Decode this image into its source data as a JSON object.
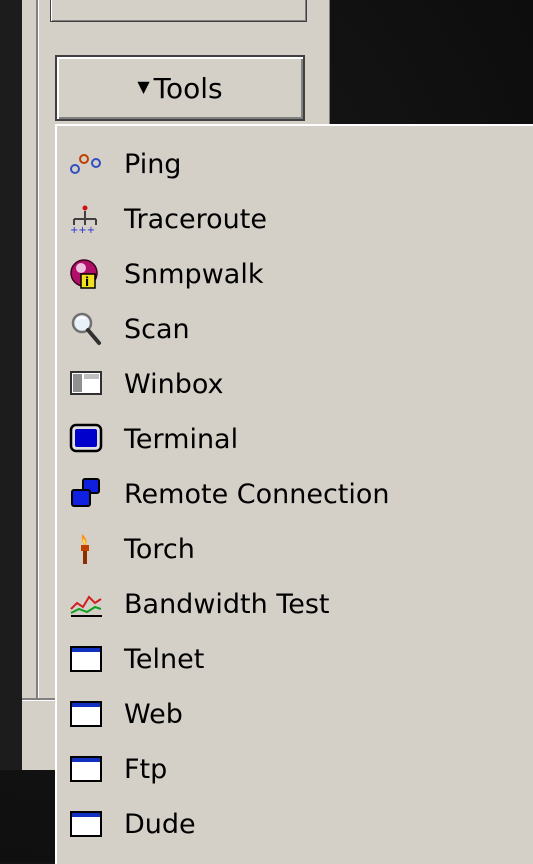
{
  "tools_button": {
    "label": "Tools"
  },
  "menu": {
    "items": [
      {
        "label": "Ping",
        "icon": "ping-icon"
      },
      {
        "label": "Traceroute",
        "icon": "traceroute-icon"
      },
      {
        "label": "Snmpwalk",
        "icon": "snmpwalk-icon"
      },
      {
        "label": "Scan",
        "icon": "magnifier-icon"
      },
      {
        "label": "Winbox",
        "icon": "winbox-icon"
      },
      {
        "label": "Terminal",
        "icon": "terminal-icon"
      },
      {
        "label": "Remote Connection",
        "icon": "remote-connection-icon"
      },
      {
        "label": "Torch",
        "icon": "torch-icon"
      },
      {
        "label": "Bandwidth Test",
        "icon": "bandwidth-test-icon"
      },
      {
        "label": "Telnet",
        "icon": "window-icon"
      },
      {
        "label": "Web",
        "icon": "window-icon"
      },
      {
        "label": "Ftp",
        "icon": "window-icon"
      },
      {
        "label": "Dude",
        "icon": "window-icon"
      }
    ]
  },
  "colors": {
    "panel": "#d4d0c8",
    "background": "#141414",
    "accent_blue": "#0000cc"
  }
}
